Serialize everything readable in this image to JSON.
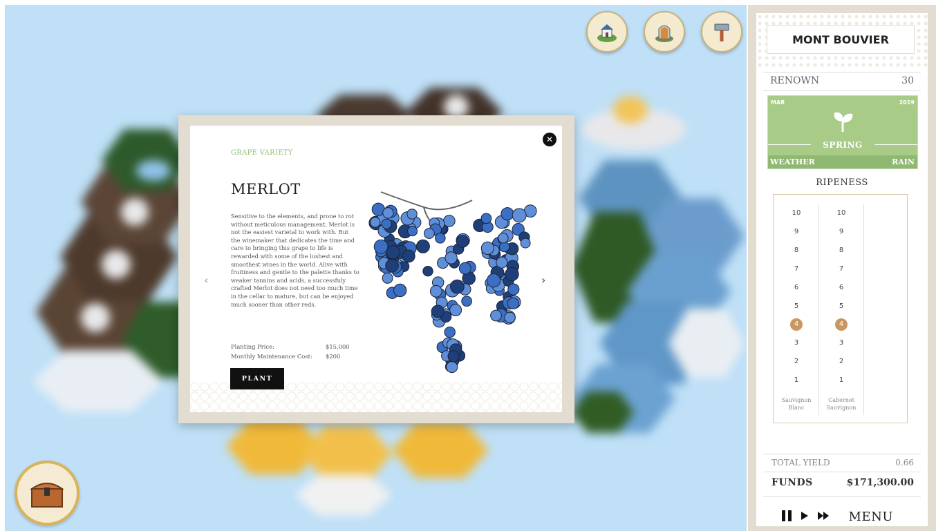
{
  "hud": {
    "top_buttons": [
      {
        "name": "chateau-icon"
      },
      {
        "name": "cellar-door-icon"
      },
      {
        "name": "hammer-icon"
      }
    ],
    "inventory_button": {
      "name": "treasure-chest-icon"
    }
  },
  "modal": {
    "category": "GRAPE VARIETY",
    "name": "MERLOT",
    "description": "Sensitive to the elements, and prone to rot without meticulous management, Merlot is not the easiest varietal to work with. But the winemaker that dedicates the time and care to bringing this grape to life is rewarded with some of the lushest and smoothest wines in the world. Alive with fruitiness and gentle to the palette thanks to weaker tannins and acids, a successfuly crafted Merlot does not need too much time in the cellar to mature, but can be enjoyed much sooner than other reds.",
    "planting_price_label": "Planting Price:",
    "planting_price": "$15,000",
    "maintenance_label": "Monthly Maintenance Cost:",
    "maintenance_cost": "$200",
    "plant_button": "PLANT",
    "close_icon": "✕",
    "prev_icon": "‹",
    "next_icon": "›",
    "grape_color": "#3b6fc4"
  },
  "panel": {
    "estate_name": "MONT BOUVIER",
    "renown_label": "RENOWN",
    "renown_value": "30",
    "season": {
      "month": "MAR",
      "year": "2019",
      "name": "SPRING",
      "icon": "sprout-icon",
      "weather_label": "WEATHER",
      "weather_value": "RAIN",
      "color": "#a9cb88"
    },
    "ripeness_title": "RIPENESS",
    "ripeness_scale": [
      "10",
      "9",
      "8",
      "7",
      "6",
      "5",
      "4",
      "3",
      "2",
      "1"
    ],
    "varieties": [
      {
        "name_line1": "Sauvignon",
        "name_line2": "Blanc",
        "ripeness": 4
      },
      {
        "name_line1": "Cabernet",
        "name_line2": "Sauvignon",
        "ripeness": 4
      }
    ],
    "total_yield_label": "TOTAL YIELD",
    "total_yield_value": "0.66",
    "funds_label": "FUNDS",
    "funds_value": "$171,300.00",
    "menu_label": "MENU"
  }
}
